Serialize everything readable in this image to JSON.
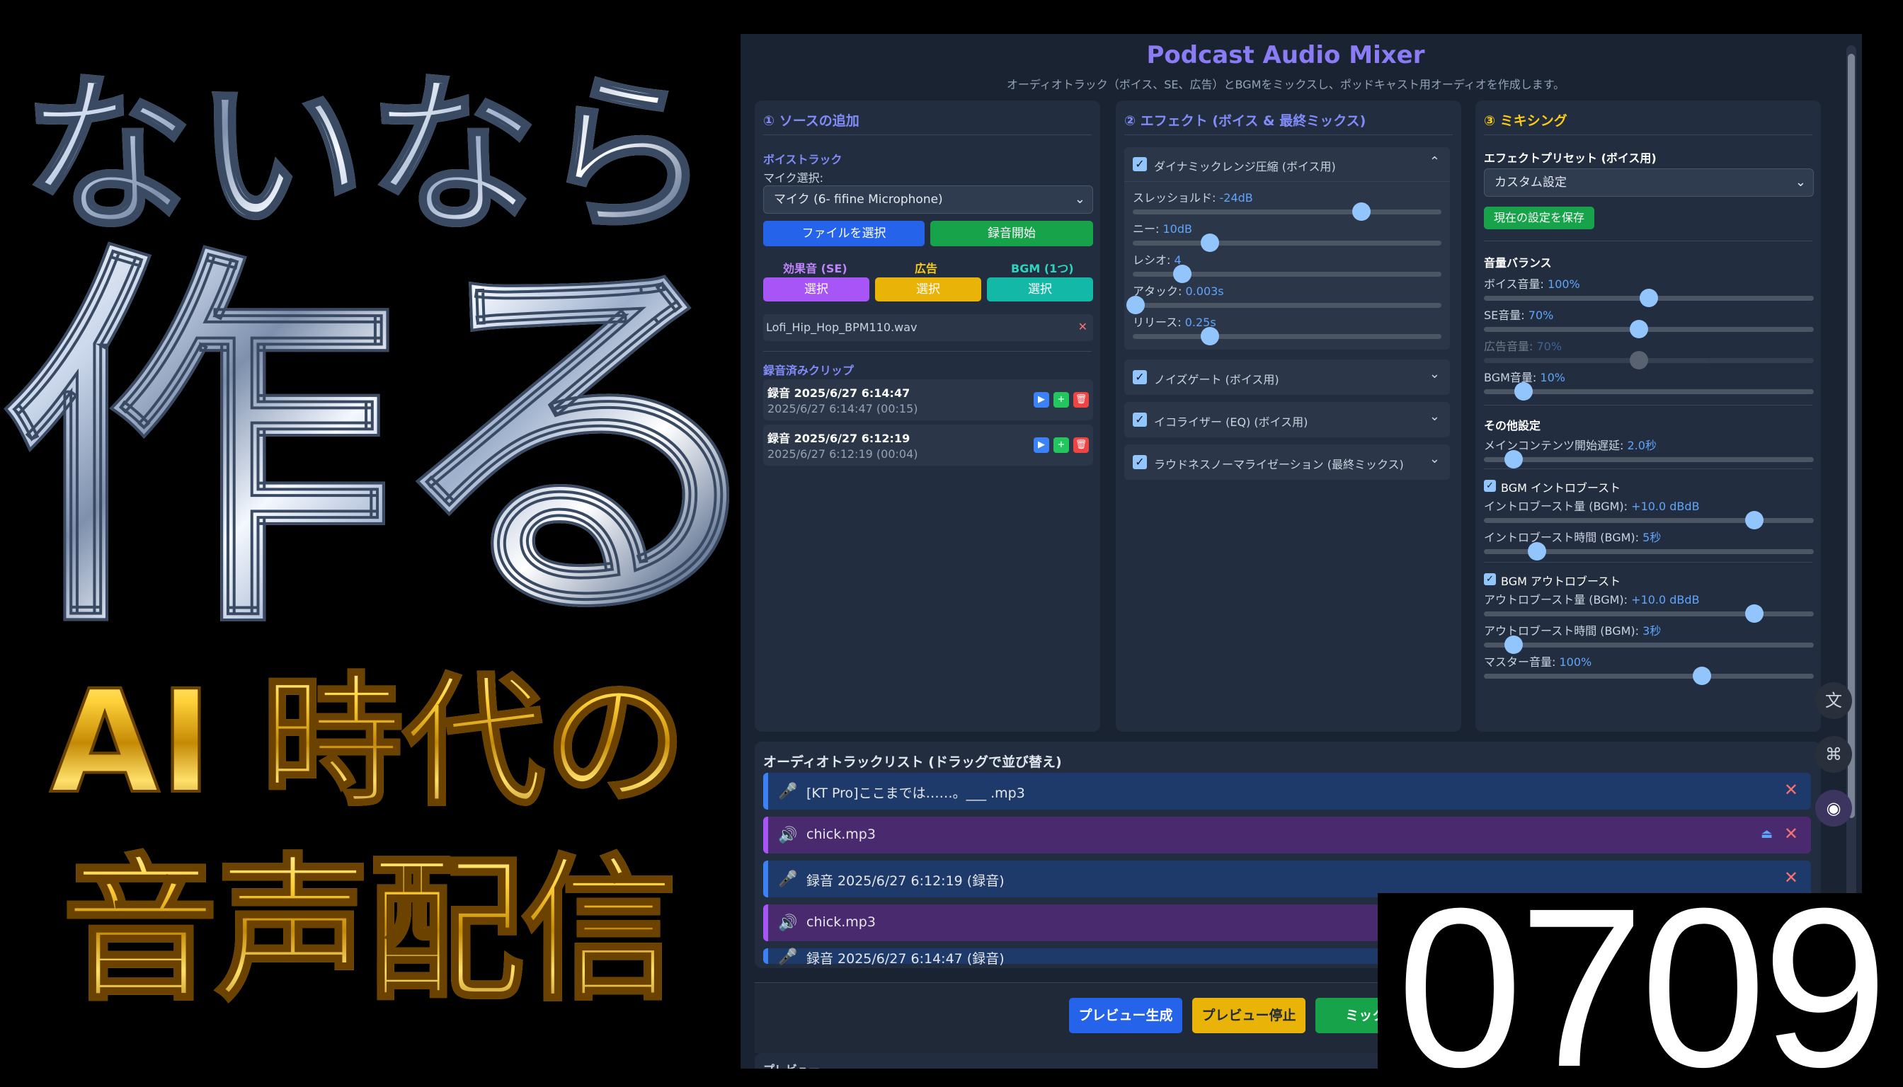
{
  "thumbnail": {
    "line1": "ないなら",
    "line2": "作る",
    "line3": "AI 時代の",
    "line4": "音声配信",
    "number": "0709"
  },
  "app": {
    "title": "Podcast Audio Mixer",
    "subtitle": "オーディオトラック（ボイス、SE、広告）とBGMをミックスし、ポッドキャスト用オーディオを作成します。"
  },
  "source": {
    "heading": "① ソースの追加",
    "voice_track_label": "ボイストラック",
    "mic_label": "マイク選択:",
    "mic_value": "マイク (6- fifine Microphone)",
    "file_button": "ファイルを選択",
    "record_button": "録音開始",
    "se_label": "効果音 (SE)",
    "ad_label": "広告",
    "bgm_label": "BGM (1つ)",
    "select_label": "選択",
    "bgm_file": "Lofi_Hip_Hop_BPM110.wav",
    "clips_heading": "録音済みクリップ",
    "clips": [
      {
        "title": "録音 2025/6/27 6:14:47",
        "meta": "2025/6/27 6:14:47 (00:15)"
      },
      {
        "title": "録音 2025/6/27 6:12:19",
        "meta": "2025/6/27 6:12:19 (00:04)"
      }
    ]
  },
  "effects": {
    "heading": "② エフェクト (ボイス & 最終ミックス)",
    "compressor": {
      "title": "ダイナミックレンジ圧縮 (ボイス用)",
      "threshold_label": "スレッショルド:",
      "threshold_value": "-24dB",
      "threshold_level": 0.74,
      "knee_label": "ニー:",
      "knee_value": "10dB",
      "knee_level": 0.25,
      "ratio_label": "レシオ:",
      "ratio_value": "4",
      "ratio_level": 0.16,
      "attack_label": "アタック:",
      "attack_value": "0.003s",
      "attack_level": 0.01,
      "release_label": "リリース:",
      "release_value": "0.25s",
      "release_level": 0.25
    },
    "noise_gate": "ノイズゲート (ボイス用)",
    "eq": "イコライザー (EQ) (ボイス用)",
    "loudness": "ラウドネスノーマライゼーション (最終ミックス)"
  },
  "mixing": {
    "heading": "③ ミキシング",
    "preset_label": "エフェクトプリセット (ボイス用)",
    "preset_value": "カスタム設定",
    "save_button": "現在の設定を保存",
    "balance_label": "音量バランス",
    "voice_label": "ボイス音量:",
    "voice_value": "100%",
    "voice_level": 0.5,
    "se_label": "SE音量:",
    "se_value": "70%",
    "se_level": 0.47,
    "ad_label": "広告音量:",
    "ad_value": "70%",
    "ad_level": 0.47,
    "bgm_label": "BGM音量:",
    "bgm_value": "10%",
    "bgm_level": 0.12,
    "other_label": "その他設定",
    "delay_label": "メインコンテンツ開始遅延:",
    "delay_value": "2.0秒",
    "delay_level": 0.09,
    "intro_boost_label": "BGM イントロブースト",
    "intro_amount_label": "イントロブースト量 (BGM):",
    "intro_amount_value": "+10.0 dBdB",
    "intro_amount_level": 0.82,
    "intro_time_label": "イントロブースト時間 (BGM):",
    "intro_time_value": "5秒",
    "intro_time_level": 0.16,
    "outro_boost_label": "BGM アウトロブースト",
    "outro_amount_label": "アウトロブースト量 (BGM):",
    "outro_amount_value": "+10.0 dBdB",
    "outro_amount_level": 0.82,
    "outro_time_label": "アウトロブースト時間 (BGM):",
    "outro_time_value": "3秒",
    "outro_time_level": 0.09,
    "master_label": "マスター音量:",
    "master_value": "100%",
    "master_level": 0.66
  },
  "tracklist": {
    "heading": "オーディオトラックリスト (ドラッグで並び替え)",
    "tracks": [
      {
        "name": "[KT Pro]ここまでは……。___ .mp3",
        "kind": "voice"
      },
      {
        "name": "chick.mp3",
        "kind": "se"
      },
      {
        "name": "録音 2025/6/27 6:12:19 (録音)",
        "kind": "voice"
      },
      {
        "name": "chick.mp3",
        "kind": "se"
      },
      {
        "name": "録音 2025/6/27 6:14:47 (録音)",
        "kind": "voice"
      }
    ]
  },
  "actions": {
    "preview_generate": "プレビュー生成",
    "preview_stop": "プレビュー停止",
    "mix": "ミックス"
  },
  "preview_heading": "プレビュー",
  "icons": {
    "mic": "mic-icon",
    "speaker": "speaker-icon",
    "play": "play-icon",
    "add": "add-icon",
    "delete": "trash-icon",
    "close": "close-icon",
    "translate": "translate-icon",
    "apps": "apps-icon",
    "assistant": "assistant-icon"
  },
  "colors": {
    "accent": "#818cf8",
    "value": "#60a5fa",
    "blue": "#2563eb",
    "green": "#16a34a",
    "purple": "#a855f7",
    "amber": "#eab308",
    "teal": "#14b8a6"
  }
}
